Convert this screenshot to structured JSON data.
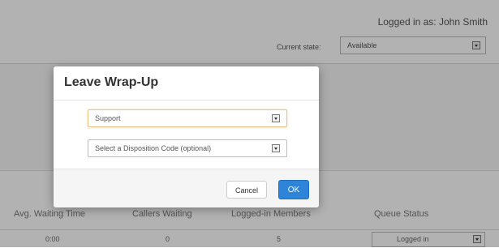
{
  "header": {
    "logged_in_text": "Logged in as: John Smith",
    "current_state_label": "Current state:",
    "current_state_value": "Available"
  },
  "queue_table": {
    "headers": [
      "Avg. Waiting Time",
      "Callers Waiting",
      "Logged-in Members",
      "Queue Status"
    ],
    "row": {
      "avg_waiting_time": "0:00",
      "callers_waiting": "0",
      "logged_in_members": "5",
      "queue_status": "Logged in"
    }
  },
  "modal": {
    "title": "Leave Wrap-Up",
    "queue_select_value": "Support",
    "disposition_select_placeholder": "Select a Disposition Code (optional)",
    "cancel_label": "Cancel",
    "ok_label": "OK"
  },
  "colors": {
    "primary_button": "#2d84d8",
    "focus_border": "#e8c184",
    "overlay": "rgba(0,0,0,0.30)"
  }
}
